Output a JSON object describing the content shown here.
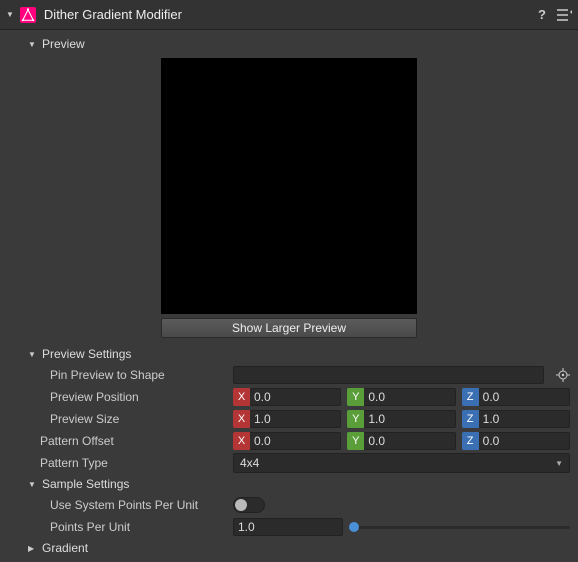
{
  "header": {
    "title": "Dither Gradient Modifier",
    "help": "?",
    "logo_color": "#ff007f"
  },
  "sections": {
    "preview": {
      "label": "Preview",
      "expanded": true
    },
    "previewSettings": {
      "label": "Preview Settings",
      "expanded": true
    },
    "sampleSettings": {
      "label": "Sample Settings",
      "expanded": true
    },
    "gradient": {
      "label": "Gradient",
      "expanded": false
    }
  },
  "preview": {
    "larger_btn": "Show Larger Preview"
  },
  "previewSettings": {
    "pinLabel": "Pin Preview to Shape",
    "pinValue": "",
    "positionLabel": "Preview Position",
    "position": {
      "x": "0.0",
      "y": "0.0",
      "z": "0.0"
    },
    "sizeLabel": "Preview Size",
    "size": {
      "x": "1.0",
      "y": "1.0",
      "z": "1.0"
    }
  },
  "patternOffset": {
    "label": "Pattern Offset",
    "value": {
      "x": "0.0",
      "y": "0.0",
      "z": "0.0"
    }
  },
  "patternType": {
    "label": "Pattern Type",
    "value": "4x4"
  },
  "sampleSettings": {
    "useSystemLabel": "Use System Points Per Unit",
    "useSystemValue": false,
    "ppuLabel": "Points Per Unit",
    "ppuValue": "1.0"
  },
  "axes": {
    "x": "X",
    "y": "Y",
    "z": "Z"
  }
}
